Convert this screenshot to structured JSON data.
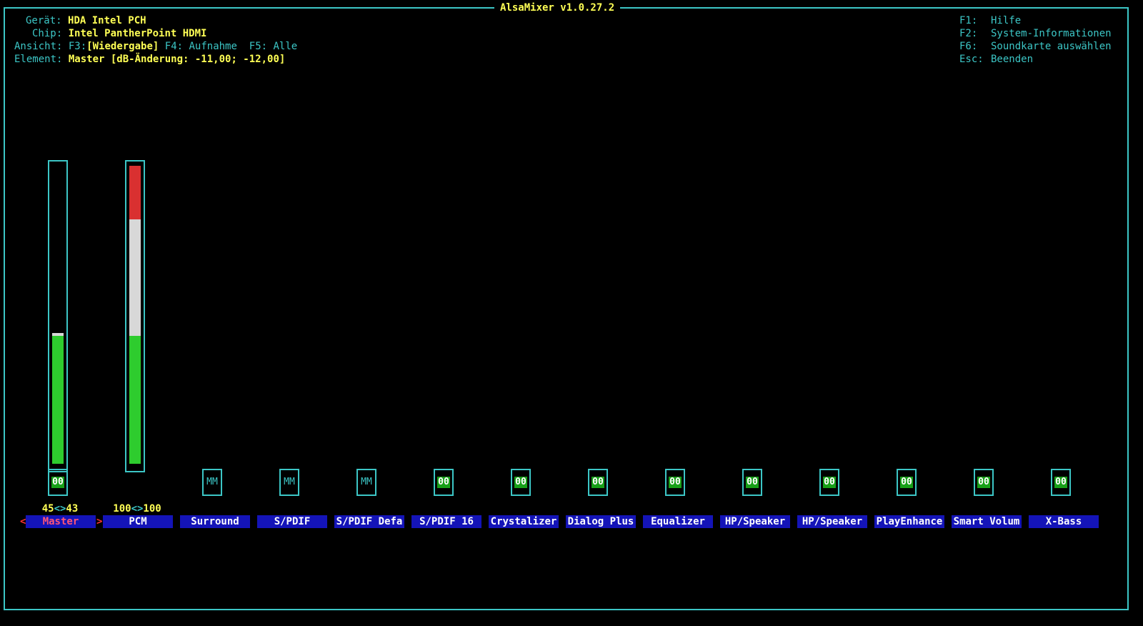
{
  "window": {
    "title": "AlsaMixer v1.0.27.2"
  },
  "info": {
    "device_label": "Gerät:",
    "device_value": "HDA Intel PCH",
    "chip_label": "Chip:",
    "chip_value": "Intel PantherPoint HDMI",
    "view_label": "Ansicht:",
    "view_f3": "F3:",
    "view_playback": "[Wiedergabe]",
    "view_f4": "F4: Aufnahme",
    "view_f5": "F5: Alle",
    "element_label": "Element:",
    "element_value": "Master [dB-Änderung: -11,00; -12,00]"
  },
  "help": [
    {
      "key": "F1:",
      "desc": "Hilfe"
    },
    {
      "key": "F2:",
      "desc": "System-Informationen"
    },
    {
      "key": "F6:",
      "desc": "Soundkarte auswählen"
    },
    {
      "key": "Esc:",
      "desc": "Beenden"
    }
  ],
  "colors": {
    "frame": "#3cc6c6",
    "highlight": "#ffff55",
    "name_bg": "#1414b8",
    "green": "#2ecc2e",
    "white": "#d8d8d8",
    "red": "#d93030",
    "switch_on": "#18a018"
  },
  "channels": [
    {
      "name": "Master",
      "selected": true,
      "volume": "45<>43",
      "level": 0.44,
      "switch": "00",
      "switch_on": true,
      "has_bar": true
    },
    {
      "name": "PCM",
      "selected": false,
      "volume": "100<>100",
      "level": 1.0,
      "switch": "",
      "switch_on": false,
      "has_bar": true
    },
    {
      "name": "Surround",
      "switch": "MM",
      "switch_on": false
    },
    {
      "name": "S/PDIF",
      "switch": "MM",
      "switch_on": false
    },
    {
      "name": "S/PDIF Defa",
      "switch": "MM",
      "switch_on": false
    },
    {
      "name": "S/PDIF 16",
      "switch": "00",
      "switch_on": true
    },
    {
      "name": "Crystalizer",
      "switch": "00",
      "switch_on": true
    },
    {
      "name": "Dialog Plus",
      "switch": "00",
      "switch_on": true
    },
    {
      "name": "Equalizer",
      "switch": "00",
      "switch_on": true
    },
    {
      "name": "HP/Speaker",
      "switch": "00",
      "switch_on": true
    },
    {
      "name": "HP/Speaker",
      "switch": "00",
      "switch_on": true
    },
    {
      "name": "PlayEnhance",
      "switch": "00",
      "switch_on": true
    },
    {
      "name": "Smart Volum",
      "switch": "00",
      "switch_on": true
    },
    {
      "name": "X-Bass",
      "switch": "00",
      "switch_on": true
    }
  ],
  "nav": {
    "left_arrow": "<",
    "right_arrow": ">"
  }
}
